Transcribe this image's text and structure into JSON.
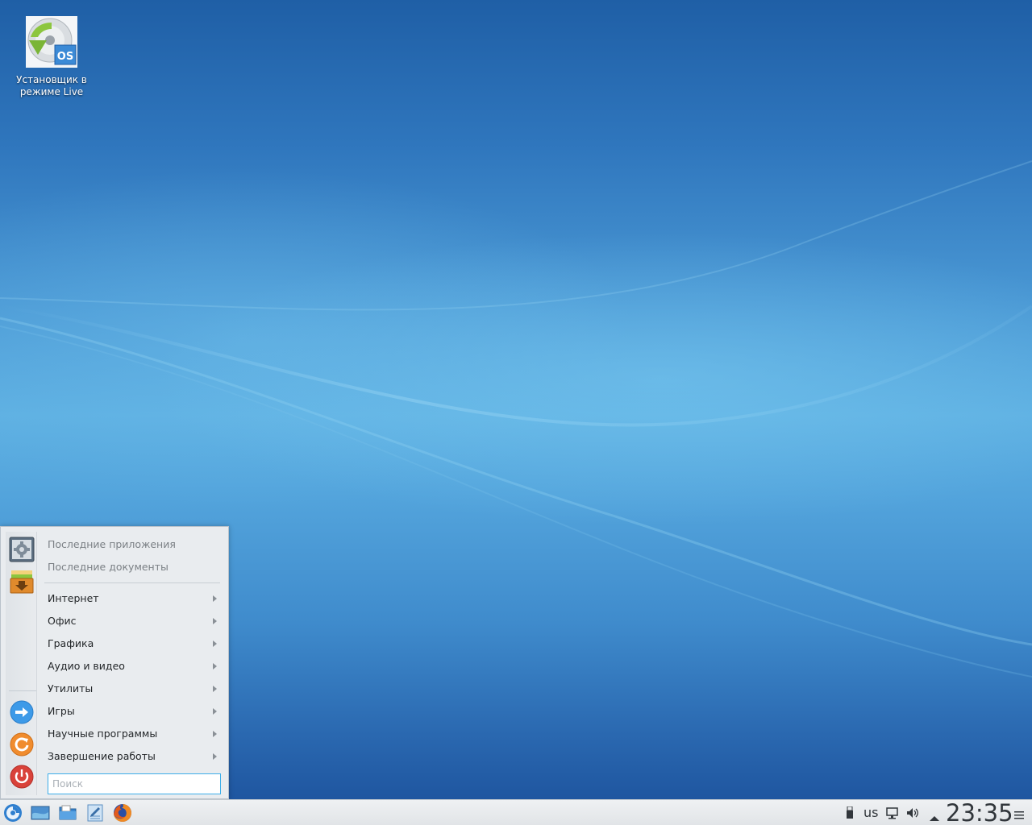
{
  "desktop": {
    "icons": [
      {
        "label_line1": "Установщик в",
        "label_line2": "режиме Live",
        "icon": "live-installer-icon"
      }
    ]
  },
  "launcher": {
    "side_icons": [
      "system-settings-icon",
      "software-install-icon",
      "switch-user-icon",
      "restart-icon",
      "shutdown-icon"
    ],
    "recent": [
      {
        "label": "Последние приложения"
      },
      {
        "label": "Последние документы"
      }
    ],
    "categories": [
      {
        "label": "Интернет"
      },
      {
        "label": "Офис"
      },
      {
        "label": "Графика"
      },
      {
        "label": "Аудио и видео"
      },
      {
        "label": "Утилиты"
      },
      {
        "label": "Игры"
      },
      {
        "label": "Научные программы"
      },
      {
        "label": "Завершение работы"
      }
    ],
    "search_placeholder": "Поиск"
  },
  "taskbar": {
    "launchers": [
      "app-menu-icon",
      "show-desktop-icon",
      "file-manager-icon",
      "text-editor-icon",
      "firefox-icon"
    ],
    "tray": {
      "keyboard_layout": "us",
      "clock": "23:35",
      "icons": [
        "usb-device-icon",
        "network-icon",
        "volume-icon",
        "tray-expand-icon",
        "panel-menu-icon"
      ]
    }
  },
  "colors": {
    "accent": "#3daee9",
    "wallpaper_top": "#1f5fa6",
    "wallpaper_mid": "#5eb0e2"
  }
}
